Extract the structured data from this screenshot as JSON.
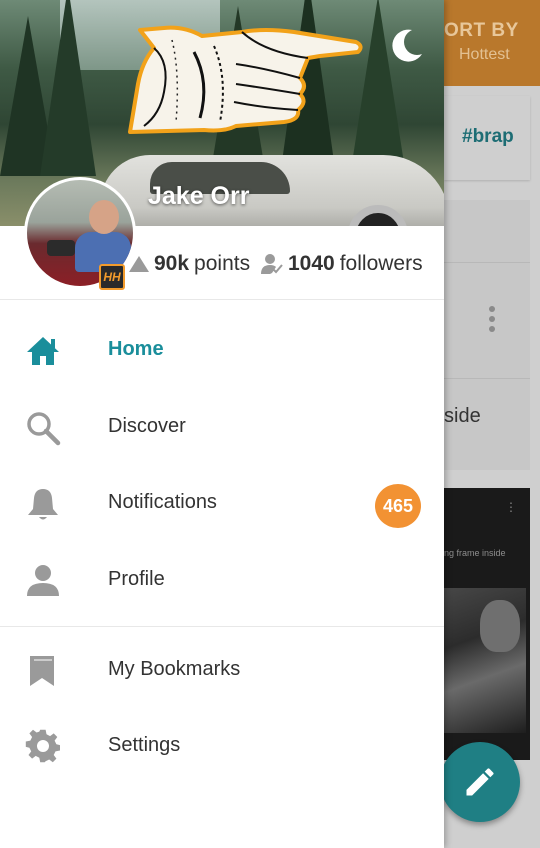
{
  "background_app": {
    "sort_title": "ORT BY",
    "sort_value": "Hottest",
    "tag": "#brap",
    "side_text": "side",
    "video_caption": "ng frame inside",
    "header_color": "#b9782c"
  },
  "drawer": {
    "user_name": "Jake Orr",
    "points_value": "90k",
    "points_label": "points",
    "followers_value": "1040",
    "followers_label": "followers",
    "badge_text": "HH",
    "nav_items": [
      {
        "label": "Home",
        "icon": "home-icon",
        "active": true
      },
      {
        "label": "Discover",
        "icon": "search-icon",
        "active": false
      },
      {
        "label": "Notifications",
        "icon": "bell-icon",
        "active": false,
        "badge": "465"
      },
      {
        "label": "Profile",
        "icon": "person-icon",
        "active": false
      },
      {
        "label": "My Bookmarks",
        "icon": "bookmark-icon",
        "active": false
      },
      {
        "label": "Settings",
        "icon": "gear-icon",
        "active": false
      }
    ]
  },
  "colors": {
    "accent": "#1a8e9b",
    "badge": "#f29233",
    "fab": "#1f7f84"
  }
}
